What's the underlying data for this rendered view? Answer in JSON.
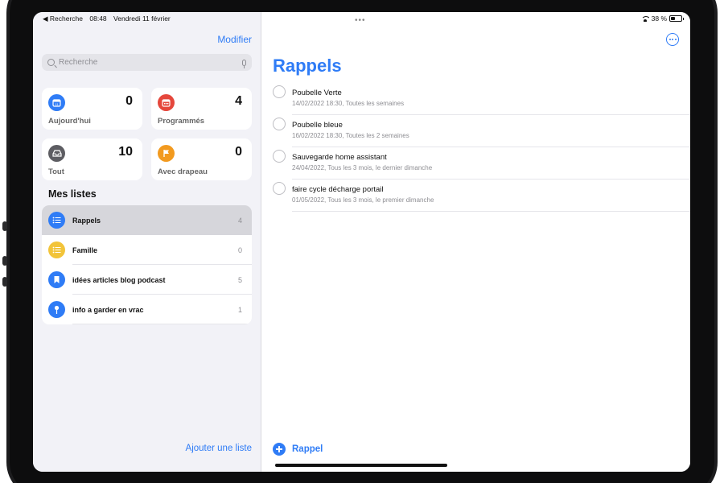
{
  "status_bar": {
    "back_app": "◀ Recherche",
    "time": "08:48",
    "date": "Vendredi 11 février",
    "battery": "38 %",
    "battery_level": 0.38,
    "multitask": "•••"
  },
  "sidebar": {
    "edit_label": "Modifier",
    "search_placeholder": "Recherche",
    "smart_lists": [
      {
        "label": "Aujourd'hui",
        "count": "0",
        "icon": "calendar-today-icon",
        "color": "#2f7cf6"
      },
      {
        "label": "Programmés",
        "count": "4",
        "icon": "calendar-scheduled-icon",
        "color": "#e5473c"
      },
      {
        "label": "Tout",
        "count": "10",
        "icon": "tray-icon",
        "color": "#5d5d62"
      },
      {
        "label": "Avec drapeau",
        "count": "0",
        "icon": "flag-icon",
        "color": "#f29a1f"
      }
    ],
    "my_lists_title": "Mes listes",
    "lists": [
      {
        "name": "Rappels",
        "count": "4",
        "icon": "list-icon",
        "color": "#2f7cf6",
        "selected": true
      },
      {
        "name": "Famille",
        "count": "0",
        "icon": "list-icon",
        "color": "#f2c43a",
        "selected": false
      },
      {
        "name": "idées articles blog podcast",
        "count": "5",
        "icon": "bookmark-icon",
        "color": "#2f7cf6",
        "selected": false
      },
      {
        "name": "info a garder en vrac",
        "count": "1",
        "icon": "pin-icon",
        "color": "#2f7cf6",
        "selected": false
      }
    ],
    "add_list_label": "Ajouter une liste"
  },
  "main": {
    "title": "Rappels",
    "reminders": [
      {
        "title": "Poubelle Verte",
        "detail": "14/02/2022 18:30, Toutes les semaines"
      },
      {
        "title": "Poubelle bleue",
        "detail": "16/02/2022 18:30, Toutes les 2 semaines"
      },
      {
        "title": "Sauvegarde home assistant",
        "detail": "24/04/2022, Tous les 3 mois, le dernier dimanche"
      },
      {
        "title": "faire cycle décharge portail",
        "detail": "01/05/2022, Tous les 3 mois, le premier dimanche"
      }
    ],
    "add_reminder_label": "Rappel"
  },
  "colors": {
    "accent": "#2f7cf6",
    "sidebar_bg": "#f2f2f7"
  }
}
